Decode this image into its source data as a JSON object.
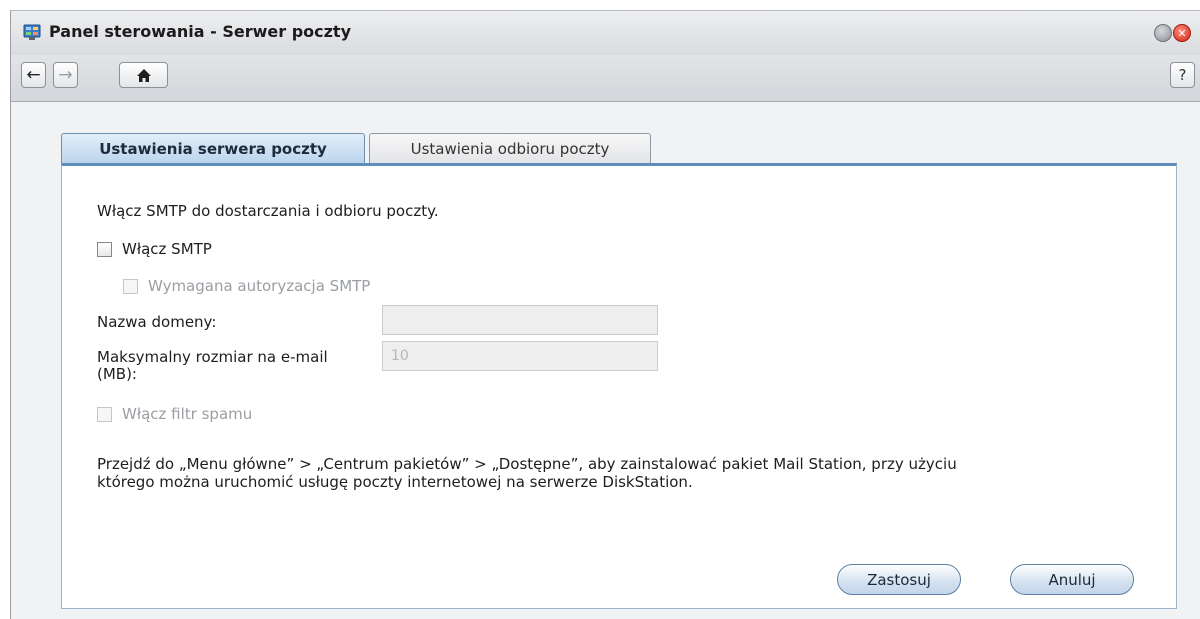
{
  "window": {
    "title": "Panel sterowania - Serwer poczty",
    "app_icon": "control-panel-icon"
  },
  "toolbar": {
    "back_icon": "←",
    "forward_icon": "→",
    "home_icon": "⌂",
    "help_label": "?"
  },
  "tabs": [
    {
      "label": "Ustawienia serwera poczty",
      "active": true
    },
    {
      "label": "Ustawienia odbioru poczty",
      "active": false
    }
  ],
  "content": {
    "intro": "Włącz SMTP do dostarczania i odbioru poczty.",
    "enable_smtp": {
      "label": "Włącz SMTP",
      "checked": false
    },
    "smtp_auth": {
      "label": "Wymagana autoryzacja SMTP",
      "checked": false,
      "disabled": true
    },
    "domain_name": {
      "label": "Nazwa domeny:",
      "value": ""
    },
    "max_size": {
      "label_line1": "Maksymalny rozmiar na e-mail",
      "label_line2": "(MB):",
      "value": "10"
    },
    "spam_filter": {
      "label": "Włącz filtr spamu",
      "checked": false,
      "disabled": true
    },
    "note_line1": "Przejdź do „Menu główne” > „Centrum pakietów” > „Dostępne”, aby zainstalować pakiet Mail Station, przy użyciu",
    "note_line2": "którego można uruchomić usługę poczty internetowej na serwerze DiskStation."
  },
  "buttons": {
    "apply": "Zastosuj",
    "cancel": "Anuluj"
  },
  "colors": {
    "accent": "#5e8db9",
    "close": "#d1261b"
  }
}
